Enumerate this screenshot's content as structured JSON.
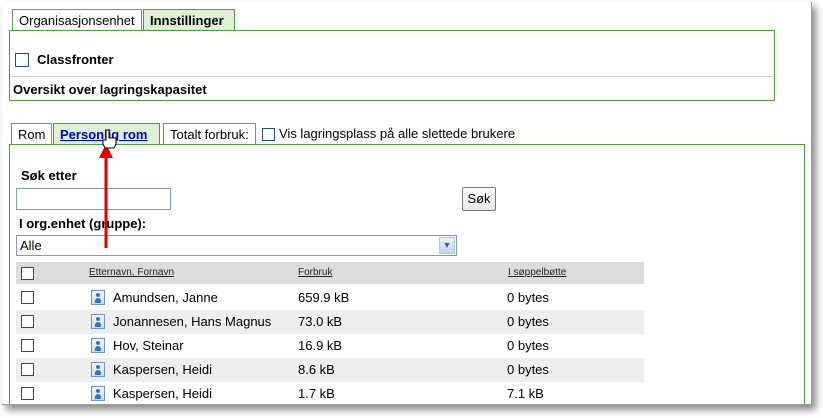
{
  "top_tabs": [
    {
      "label": "Organisasjonsenhet",
      "active": false
    },
    {
      "label": "Innstillinger",
      "active": true
    }
  ],
  "settings": {
    "classfronter_label": "Classfronter",
    "classfronter_checked": false,
    "section_title": "Oversikt over lagringskapasitet"
  },
  "storage_tabs": [
    {
      "label": "Rom",
      "active": false
    },
    {
      "label": "Personlig rom",
      "active": true
    },
    {
      "label": "Totalt forbruk:",
      "active": false
    }
  ],
  "show_deleted": {
    "label": "Vis lagringsplass på alle slettede brukere",
    "checked": false
  },
  "search": {
    "label": "Søk etter",
    "value": "",
    "button_label": "Søk",
    "group_label": "I org.enhet (gruppe):",
    "group_selected": "Alle"
  },
  "table": {
    "headers": {
      "name": "Etternavn, Fornavn",
      "usage": "Forbruk",
      "trash": "I søppelbøtte"
    },
    "rows": [
      {
        "name": "Amundsen, Janne",
        "usage": "659.9 kB",
        "trash": "0 bytes"
      },
      {
        "name": "Jonannesen, Hans Magnus",
        "usage": "73.0 kB",
        "trash": "0 bytes"
      },
      {
        "name": "Hov, Steinar",
        "usage": "16.9 kB",
        "trash": "0 bytes"
      },
      {
        "name": "Kaspersen, Heidi",
        "usage": "8.6 kB",
        "trash": "0 bytes"
      },
      {
        "name": "Kaspersen, Heidi",
        "usage": "1.7 kB",
        "trash": "7.1 kB"
      }
    ]
  },
  "colors": {
    "tab_border": "#4f9a3e",
    "active_tab_bg": "#dff0d4",
    "link": "#0000cc",
    "arrow": "#e00000"
  }
}
